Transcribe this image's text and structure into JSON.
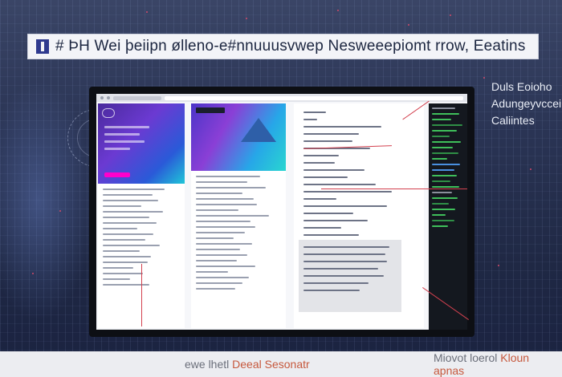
{
  "title_bar": {
    "text": "# ÞH  Wei þeiipn ølleno-e#nnuuusvwep Nesweeepiomt rrow, Eeatins"
  },
  "side_caption": {
    "line1": "Duls Eoioho",
    "line2": "Adungeyvccei",
    "line3": "Caliintes"
  },
  "footer": {
    "left_a": "ewe lhetl",
    "left_accent": "Deeal Sesonatr",
    "right_a": "Miovot loerol",
    "right_accent": "Kloun apnas"
  },
  "colors": {
    "background": "#2a3454",
    "accent_red": "#d3414f",
    "hero_purple": "#6b3ad2",
    "hero_cyan": "#1fc6d8",
    "terminal_green": "#3fbf5a"
  }
}
